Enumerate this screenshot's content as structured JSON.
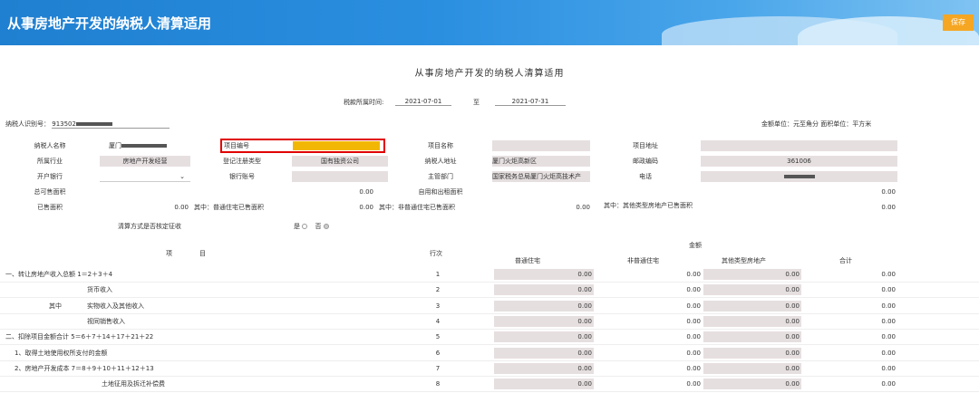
{
  "header": {
    "title": "从事房地产开发的纳税人清算适用",
    "save_label": "保存"
  },
  "form": {
    "title": "从事房地产开发的纳税人清算适用",
    "period_label": "税款所属时间:",
    "period_from": "2021-07-01",
    "period_to_label": "至",
    "period_to": "2021-07-31",
    "taxid_label": "纳税人识别号：",
    "taxid_value": "913502",
    "units": "金额单位：元至角分   面积单位：平方米"
  },
  "info": {
    "r1": {
      "l1": "纳税人名称",
      "v1": "厦门",
      "l2": "项目编号",
      "l3": "项目名称",
      "l4": "项目地址"
    },
    "r2": {
      "l1": "所属行业",
      "v1": "房地产开发经营",
      "l2": "登记注册类型",
      "v2": "国有独资公司",
      "l3": "纳税人地址",
      "v3": "厦门火炬高新区",
      "l4": "邮政编码",
      "v4": "361006"
    },
    "r3": {
      "l1": "开户银行",
      "v1": "",
      "l2": "银行账号",
      "l3": "主管部门",
      "v3": "国家税务总局厦门火炬高技术产",
      "l4": "电话",
      "v4": ""
    },
    "r4": {
      "l1": "总可售面积",
      "v2": "0.00",
      "l3": "自用和出租面积",
      "v4": "0.00"
    },
    "r5": {
      "l1": "已售面积",
      "v1": "0.00",
      "l2": "其中：普通住宅已售面积",
      "v2": "0.00",
      "l3": "其中：非普通住宅已售面积",
      "v3": "0.00",
      "l4": "其中：其他类型房地产已售面积",
      "v4": "0.00"
    },
    "r6": {
      "label": "清算方式是否核定征收",
      "yes": "是",
      "no": "否"
    }
  },
  "table": {
    "col_item": "项",
    "col_item2": "目",
    "col_line": "行次",
    "col_amount": "金额",
    "col_ordinary": "普通住宅",
    "col_nonordinary": "非普通住宅",
    "col_other": "其他类型房地产",
    "col_total": "合计",
    "rows": [
      {
        "pre": "",
        "item": "一、转让房地产收入总额 1＝2＋3＋4",
        "line": "1",
        "a": "0.00",
        "b": "0.00",
        "c": "0.00",
        "d": "0.00"
      },
      {
        "pre": "",
        "item": "货币收入",
        "line": "2",
        "a": "0.00",
        "b": "0.00",
        "c": "0.00",
        "d": "0.00"
      },
      {
        "pre": "其中",
        "item": "实物收入及其他收入",
        "line": "3",
        "a": "0.00",
        "b": "0.00",
        "c": "0.00",
        "d": "0.00"
      },
      {
        "pre": "",
        "item": "视同销售收入",
        "line": "4",
        "a": "0.00",
        "b": "0.00",
        "c": "0.00",
        "d": "0.00"
      },
      {
        "pre": "",
        "item": "二、扣除项目金额合计 5＝6＋7＋14＋17＋21＋22",
        "line": "5",
        "a": "0.00",
        "b": "0.00",
        "c": "0.00",
        "d": "0.00"
      },
      {
        "pre": "",
        "item": "1、取得土地使用权所支付的金额",
        "line": "6",
        "a": "0.00",
        "b": "0.00",
        "c": "0.00",
        "d": "0.00"
      },
      {
        "pre": "",
        "item": "2、房地产开发成本 7＝8＋9＋10＋11＋12＋13",
        "line": "7",
        "a": "0.00",
        "b": "0.00",
        "c": "0.00",
        "d": "0.00"
      },
      {
        "pre": "",
        "item": "土地征用及拆迁补偿费",
        "line": "8",
        "a": "0.00",
        "b": "0.00",
        "c": "0.00",
        "d": "0.00"
      }
    ]
  }
}
